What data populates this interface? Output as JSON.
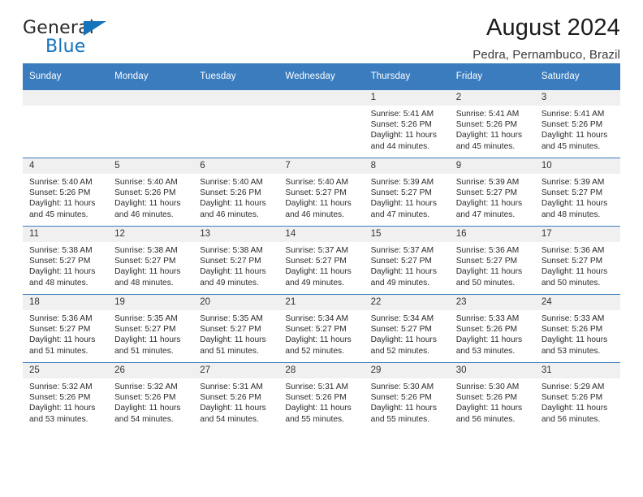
{
  "brand": {
    "name_part1": "General",
    "name_part2": "Blue",
    "flag_icon": "triangle-flag-icon",
    "accent_color": "#1573bb"
  },
  "header": {
    "title": "August 2024",
    "location": "Pedra, Pernambuco, Brazil"
  },
  "theme": {
    "header_row_bg": "#3a7cbe",
    "daynum_bg": "#f0f0f0",
    "grid_line": "#3a7cbe",
    "text": "#2b2b2b"
  },
  "weekdays": [
    "Sunday",
    "Monday",
    "Tuesday",
    "Wednesday",
    "Thursday",
    "Friday",
    "Saturday"
  ],
  "weeks": [
    [
      {
        "day": "",
        "sunrise": "",
        "sunset": "",
        "daylight_line1": "",
        "daylight_line2": ""
      },
      {
        "day": "",
        "sunrise": "",
        "sunset": "",
        "daylight_line1": "",
        "daylight_line2": ""
      },
      {
        "day": "",
        "sunrise": "",
        "sunset": "",
        "daylight_line1": "",
        "daylight_line2": ""
      },
      {
        "day": "",
        "sunrise": "",
        "sunset": "",
        "daylight_line1": "",
        "daylight_line2": ""
      },
      {
        "day": "1",
        "sunrise": "Sunrise: 5:41 AM",
        "sunset": "Sunset: 5:26 PM",
        "daylight_line1": "Daylight: 11 hours",
        "daylight_line2": "and 44 minutes."
      },
      {
        "day": "2",
        "sunrise": "Sunrise: 5:41 AM",
        "sunset": "Sunset: 5:26 PM",
        "daylight_line1": "Daylight: 11 hours",
        "daylight_line2": "and 45 minutes."
      },
      {
        "day": "3",
        "sunrise": "Sunrise: 5:41 AM",
        "sunset": "Sunset: 5:26 PM",
        "daylight_line1": "Daylight: 11 hours",
        "daylight_line2": "and 45 minutes."
      }
    ],
    [
      {
        "day": "4",
        "sunrise": "Sunrise: 5:40 AM",
        "sunset": "Sunset: 5:26 PM",
        "daylight_line1": "Daylight: 11 hours",
        "daylight_line2": "and 45 minutes."
      },
      {
        "day": "5",
        "sunrise": "Sunrise: 5:40 AM",
        "sunset": "Sunset: 5:26 PM",
        "daylight_line1": "Daylight: 11 hours",
        "daylight_line2": "and 46 minutes."
      },
      {
        "day": "6",
        "sunrise": "Sunrise: 5:40 AM",
        "sunset": "Sunset: 5:26 PM",
        "daylight_line1": "Daylight: 11 hours",
        "daylight_line2": "and 46 minutes."
      },
      {
        "day": "7",
        "sunrise": "Sunrise: 5:40 AM",
        "sunset": "Sunset: 5:27 PM",
        "daylight_line1": "Daylight: 11 hours",
        "daylight_line2": "and 46 minutes."
      },
      {
        "day": "8",
        "sunrise": "Sunrise: 5:39 AM",
        "sunset": "Sunset: 5:27 PM",
        "daylight_line1": "Daylight: 11 hours",
        "daylight_line2": "and 47 minutes."
      },
      {
        "day": "9",
        "sunrise": "Sunrise: 5:39 AM",
        "sunset": "Sunset: 5:27 PM",
        "daylight_line1": "Daylight: 11 hours",
        "daylight_line2": "and 47 minutes."
      },
      {
        "day": "10",
        "sunrise": "Sunrise: 5:39 AM",
        "sunset": "Sunset: 5:27 PM",
        "daylight_line1": "Daylight: 11 hours",
        "daylight_line2": "and 48 minutes."
      }
    ],
    [
      {
        "day": "11",
        "sunrise": "Sunrise: 5:38 AM",
        "sunset": "Sunset: 5:27 PM",
        "daylight_line1": "Daylight: 11 hours",
        "daylight_line2": "and 48 minutes."
      },
      {
        "day": "12",
        "sunrise": "Sunrise: 5:38 AM",
        "sunset": "Sunset: 5:27 PM",
        "daylight_line1": "Daylight: 11 hours",
        "daylight_line2": "and 48 minutes."
      },
      {
        "day": "13",
        "sunrise": "Sunrise: 5:38 AM",
        "sunset": "Sunset: 5:27 PM",
        "daylight_line1": "Daylight: 11 hours",
        "daylight_line2": "and 49 minutes."
      },
      {
        "day": "14",
        "sunrise": "Sunrise: 5:37 AM",
        "sunset": "Sunset: 5:27 PM",
        "daylight_line1": "Daylight: 11 hours",
        "daylight_line2": "and 49 minutes."
      },
      {
        "day": "15",
        "sunrise": "Sunrise: 5:37 AM",
        "sunset": "Sunset: 5:27 PM",
        "daylight_line1": "Daylight: 11 hours",
        "daylight_line2": "and 49 minutes."
      },
      {
        "day": "16",
        "sunrise": "Sunrise: 5:36 AM",
        "sunset": "Sunset: 5:27 PM",
        "daylight_line1": "Daylight: 11 hours",
        "daylight_line2": "and 50 minutes."
      },
      {
        "day": "17",
        "sunrise": "Sunrise: 5:36 AM",
        "sunset": "Sunset: 5:27 PM",
        "daylight_line1": "Daylight: 11 hours",
        "daylight_line2": "and 50 minutes."
      }
    ],
    [
      {
        "day": "18",
        "sunrise": "Sunrise: 5:36 AM",
        "sunset": "Sunset: 5:27 PM",
        "daylight_line1": "Daylight: 11 hours",
        "daylight_line2": "and 51 minutes."
      },
      {
        "day": "19",
        "sunrise": "Sunrise: 5:35 AM",
        "sunset": "Sunset: 5:27 PM",
        "daylight_line1": "Daylight: 11 hours",
        "daylight_line2": "and 51 minutes."
      },
      {
        "day": "20",
        "sunrise": "Sunrise: 5:35 AM",
        "sunset": "Sunset: 5:27 PM",
        "daylight_line1": "Daylight: 11 hours",
        "daylight_line2": "and 51 minutes."
      },
      {
        "day": "21",
        "sunrise": "Sunrise: 5:34 AM",
        "sunset": "Sunset: 5:27 PM",
        "daylight_line1": "Daylight: 11 hours",
        "daylight_line2": "and 52 minutes."
      },
      {
        "day": "22",
        "sunrise": "Sunrise: 5:34 AM",
        "sunset": "Sunset: 5:27 PM",
        "daylight_line1": "Daylight: 11 hours",
        "daylight_line2": "and 52 minutes."
      },
      {
        "day": "23",
        "sunrise": "Sunrise: 5:33 AM",
        "sunset": "Sunset: 5:26 PM",
        "daylight_line1": "Daylight: 11 hours",
        "daylight_line2": "and 53 minutes."
      },
      {
        "day": "24",
        "sunrise": "Sunrise: 5:33 AM",
        "sunset": "Sunset: 5:26 PM",
        "daylight_line1": "Daylight: 11 hours",
        "daylight_line2": "and 53 minutes."
      }
    ],
    [
      {
        "day": "25",
        "sunrise": "Sunrise: 5:32 AM",
        "sunset": "Sunset: 5:26 PM",
        "daylight_line1": "Daylight: 11 hours",
        "daylight_line2": "and 53 minutes."
      },
      {
        "day": "26",
        "sunrise": "Sunrise: 5:32 AM",
        "sunset": "Sunset: 5:26 PM",
        "daylight_line1": "Daylight: 11 hours",
        "daylight_line2": "and 54 minutes."
      },
      {
        "day": "27",
        "sunrise": "Sunrise: 5:31 AM",
        "sunset": "Sunset: 5:26 PM",
        "daylight_line1": "Daylight: 11 hours",
        "daylight_line2": "and 54 minutes."
      },
      {
        "day": "28",
        "sunrise": "Sunrise: 5:31 AM",
        "sunset": "Sunset: 5:26 PM",
        "daylight_line1": "Daylight: 11 hours",
        "daylight_line2": "and 55 minutes."
      },
      {
        "day": "29",
        "sunrise": "Sunrise: 5:30 AM",
        "sunset": "Sunset: 5:26 PM",
        "daylight_line1": "Daylight: 11 hours",
        "daylight_line2": "and 55 minutes."
      },
      {
        "day": "30",
        "sunrise": "Sunrise: 5:30 AM",
        "sunset": "Sunset: 5:26 PM",
        "daylight_line1": "Daylight: 11 hours",
        "daylight_line2": "and 56 minutes."
      },
      {
        "day": "31",
        "sunrise": "Sunrise: 5:29 AM",
        "sunset": "Sunset: 5:26 PM",
        "daylight_line1": "Daylight: 11 hours",
        "daylight_line2": "and 56 minutes."
      }
    ]
  ]
}
